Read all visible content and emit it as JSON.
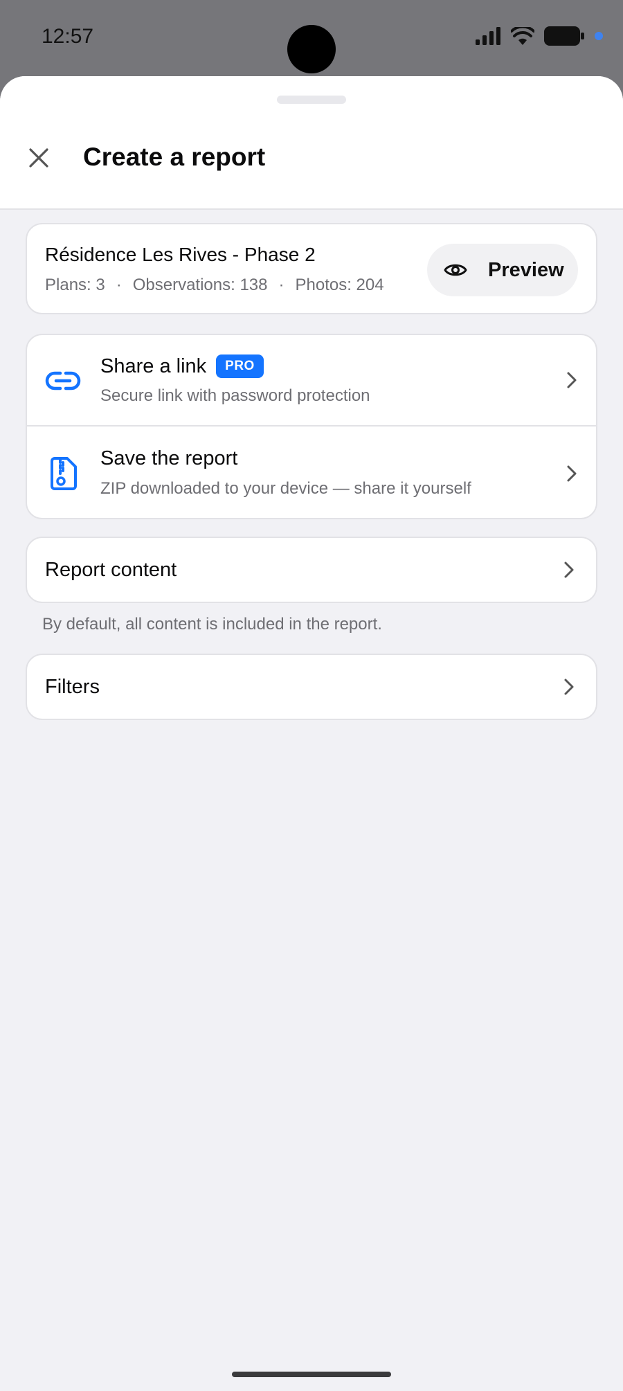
{
  "status_bar": {
    "time": "12:57"
  },
  "header": {
    "title": "Create a report",
    "close_icon": "close-icon"
  },
  "project": {
    "name": "Résidence Les Rives - Phase 2",
    "stats": [
      "Plans: 3",
      "·",
      "Observations: 138",
      "·",
      "Photos: 204"
    ],
    "preview_label": "Preview"
  },
  "actions": [
    {
      "title": "Share a link",
      "badge": "PRO",
      "subtitle": "Secure link with password protection",
      "icon": "link-icon"
    },
    {
      "title": "Save the report",
      "subtitle": "ZIP downloaded to your device — share it yourself",
      "icon": "zip-file-icon"
    }
  ],
  "report_content": {
    "label": "Report content",
    "hint": "By default, all content is included in the report."
  },
  "filters": {
    "label": "Filters"
  },
  "colors": {
    "accent": "#1474ff",
    "background": "#f1f1f5"
  }
}
